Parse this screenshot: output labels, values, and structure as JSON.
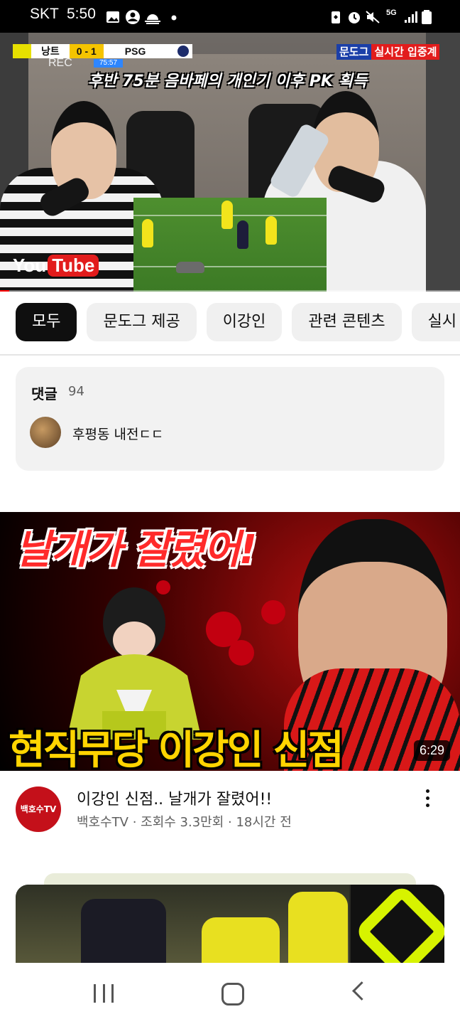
{
  "status_bar": {
    "carrier": "SKT",
    "time": "5:50",
    "network": "5G"
  },
  "player": {
    "score_bug": {
      "home_team": "낭트",
      "score": "0 - 1",
      "away_team": "PSG",
      "clock": "75:57"
    },
    "rec_label": "REC",
    "caption": "후반 75분 음바페의 개인기 이후 PK 획득",
    "channel_badge": "문도그",
    "live_badge": "실시간 입중계",
    "youtube_you": "You",
    "youtube_tube": "Tube",
    "progress_fraction": 0.02
  },
  "chips": [
    {
      "label": "모두",
      "active": true
    },
    {
      "label": "문도그 제공",
      "active": false
    },
    {
      "label": "이강인",
      "active": false
    },
    {
      "label": "관련 콘텐츠",
      "active": false
    },
    {
      "label": "실시",
      "active": false
    }
  ],
  "comments": {
    "title": "댓글",
    "count": "94",
    "top_comment": "후평동 내전ㄷㄷ"
  },
  "video": {
    "thumbnail_headline": "날개가 잘렸어!",
    "thumbnail_subline": "현직무당 이강인 신점",
    "duration": "6:29",
    "channel_avatar_text": "백호수TV",
    "title": "이강인 신점.. 날개가 잘렸어!!",
    "subtitle": "백호수TV · 조회수 3.3만회 · 18시간 전"
  },
  "colors": {
    "accent_red": "#ff0000",
    "chip_active_bg": "#0f0f0f",
    "chip_bg": "#f0f0f0"
  }
}
